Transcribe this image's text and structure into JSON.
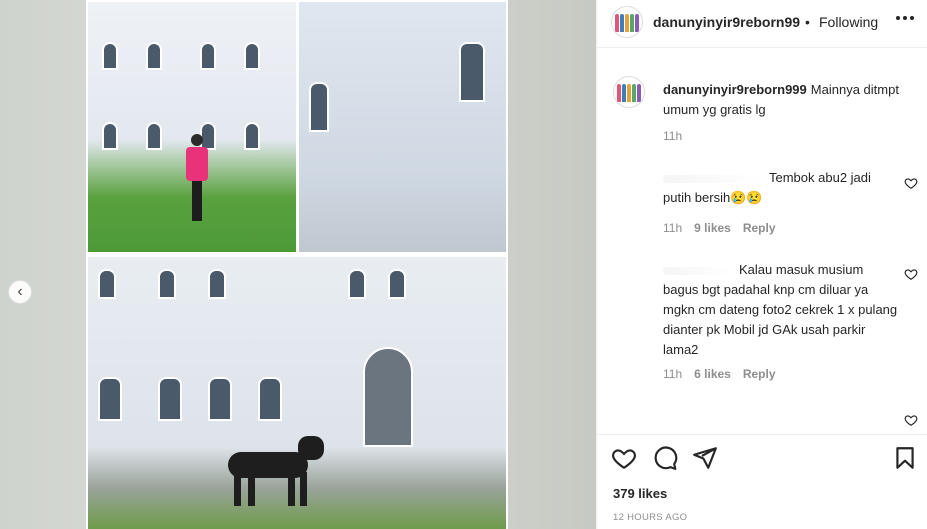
{
  "media": {
    "prev_icon": "chevron-left-icon",
    "prev_glyph": "‹"
  },
  "header": {
    "username": "danunyinyir9reborn99",
    "separator": "•",
    "follow_label": "Following",
    "more_icon": "more-horizontal-icon"
  },
  "caption": {
    "username": "danunyinyir9reborn999",
    "text": "Mainnya ditmpt umum yg gratis lg",
    "time": "11h"
  },
  "comments": [
    {
      "text": "Tembok abu2 jadi putih bersih😢😢",
      "time": "11h",
      "likes": "9 likes",
      "reply": "Reply"
    },
    {
      "text": "Kalau masuk musium bagus bgt padahal knp cm diluar ya mgkn cm dateng foto2 cekrek 1 x pulang dianter pk Mobil jd GAk usah parkir lama2",
      "time": "11h",
      "likes": "6 likes",
      "reply": "Reply"
    }
  ],
  "actions": {
    "like_icon": "heart-icon",
    "comment_icon": "comment-icon",
    "share_icon": "share-icon",
    "save_icon": "bookmark-icon"
  },
  "likes_count": "379 likes",
  "posted": "12 HOURS AGO",
  "colors": {
    "text": "#262626",
    "secondary": "#8e8e8e",
    "border": "#efefef"
  }
}
